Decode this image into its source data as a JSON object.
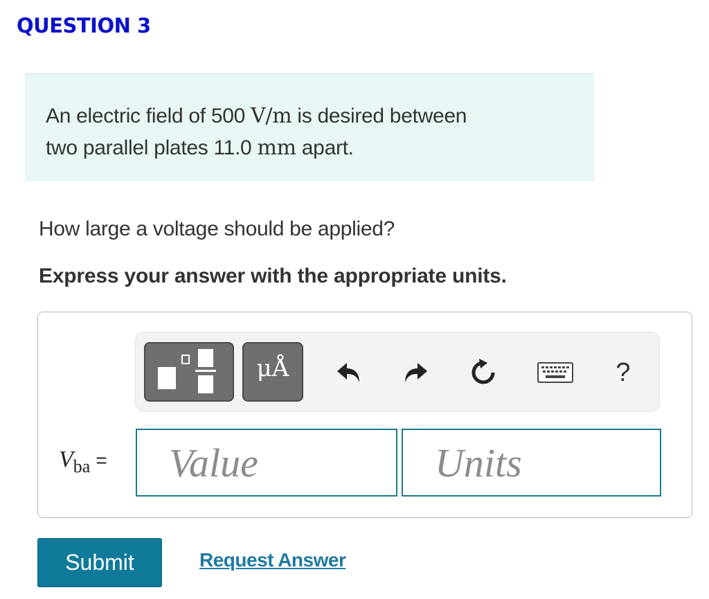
{
  "question": {
    "title": "QUESTION 3"
  },
  "intro": {
    "line1_pre": "An electric field of 500 ",
    "line1_unit": "V/m",
    "line1_post": " is desired between",
    "line2_pre": "two parallel plates 11.0 ",
    "line2_unit": "mm",
    "line2_post": " apart."
  },
  "prompt": {
    "question_text": "How large a voltage should be applied?",
    "instruction_text": "Express your answer with the appropriate units."
  },
  "toolbar": {
    "units_label": "μÅ",
    "icons": [
      "templates-icon",
      "units-icon",
      "undo-icon",
      "redo-icon",
      "reset-icon",
      "keyboard-icon",
      "help-icon"
    ],
    "help_label": "?"
  },
  "answer": {
    "variable_symbol": "V",
    "variable_subscript": "ba",
    "equals": "=",
    "value_placeholder": "Value",
    "units_placeholder": "Units"
  },
  "actions": {
    "submit_label": "Submit",
    "request_answer_label": "Request Answer"
  },
  "colors": {
    "title": "#0b12c8",
    "intro_background": "#e8f6f6",
    "input_border": "#1a7a8c",
    "submit_background": "#0f7a99",
    "link": "#1f7aa3"
  }
}
